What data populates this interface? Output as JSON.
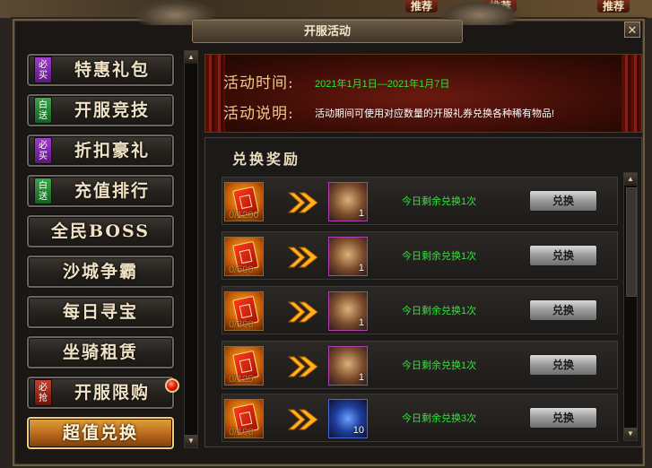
{
  "scene": {
    "tags": [
      "推荐",
      "推荐",
      "推荐"
    ]
  },
  "window": {
    "title": "开服活动",
    "close_icon": "close-icon"
  },
  "menu": {
    "items": [
      {
        "label": "特惠礼包",
        "badge": "必买",
        "badge_color": "#8a2fb8"
      },
      {
        "label": "开服竞技",
        "badge": "白送",
        "badge_color": "#2a8a36"
      },
      {
        "label": "折扣豪礼",
        "badge": "必买",
        "badge_color": "#8a2fb8"
      },
      {
        "label": "充值排行",
        "badge": "白送",
        "badge_color": "#2a8a36"
      },
      {
        "label": "全民BOSS"
      },
      {
        "label": "沙城争霸"
      },
      {
        "label": "每日寻宝"
      },
      {
        "label": "坐骑租赁"
      },
      {
        "label": "开服限购",
        "badge": "必抢",
        "badge_color": "#b8301c",
        "red_dot": true
      },
      {
        "label": "超值兑换",
        "active": true
      }
    ]
  },
  "banner": {
    "time_label": "活动时间:",
    "time_value": "2021年1月1日—2021年1月7日",
    "desc_label": "活动说明:",
    "desc_value": "活动期间可使用对应数量的开服礼券兑换各种稀有物品!"
  },
  "exchange": {
    "title": "兑换奖励",
    "rows": [
      {
        "cost": "0/1200",
        "reward_count": "1",
        "remaining": "今日剩余兑换1次",
        "button": "兑换",
        "reward_icon": "fox-mount-icon"
      },
      {
        "cost": "0/500",
        "reward_count": "1",
        "remaining": "今日剩余兑换1次",
        "button": "兑换",
        "reward_icon": "deer-mount-icon"
      },
      {
        "cost": "0/300",
        "reward_count": "1",
        "remaining": "今日剩余兑换1次",
        "button": "兑换",
        "reward_icon": "deer-mount-icon"
      },
      {
        "cost": "0/125",
        "reward_count": "1",
        "remaining": "今日剩余兑换1次",
        "button": "兑换",
        "reward_icon": "deer-mount-icon"
      },
      {
        "cost": "0/100",
        "reward_count": "10",
        "remaining": "今日剩余兑换3次",
        "button": "兑换",
        "reward_icon": "blue-gem-icon"
      }
    ]
  },
  "colors": {
    "accent_gold": "#e0a23b",
    "remaining_green": "#33e33b",
    "banner_red": "#6b1a10"
  }
}
